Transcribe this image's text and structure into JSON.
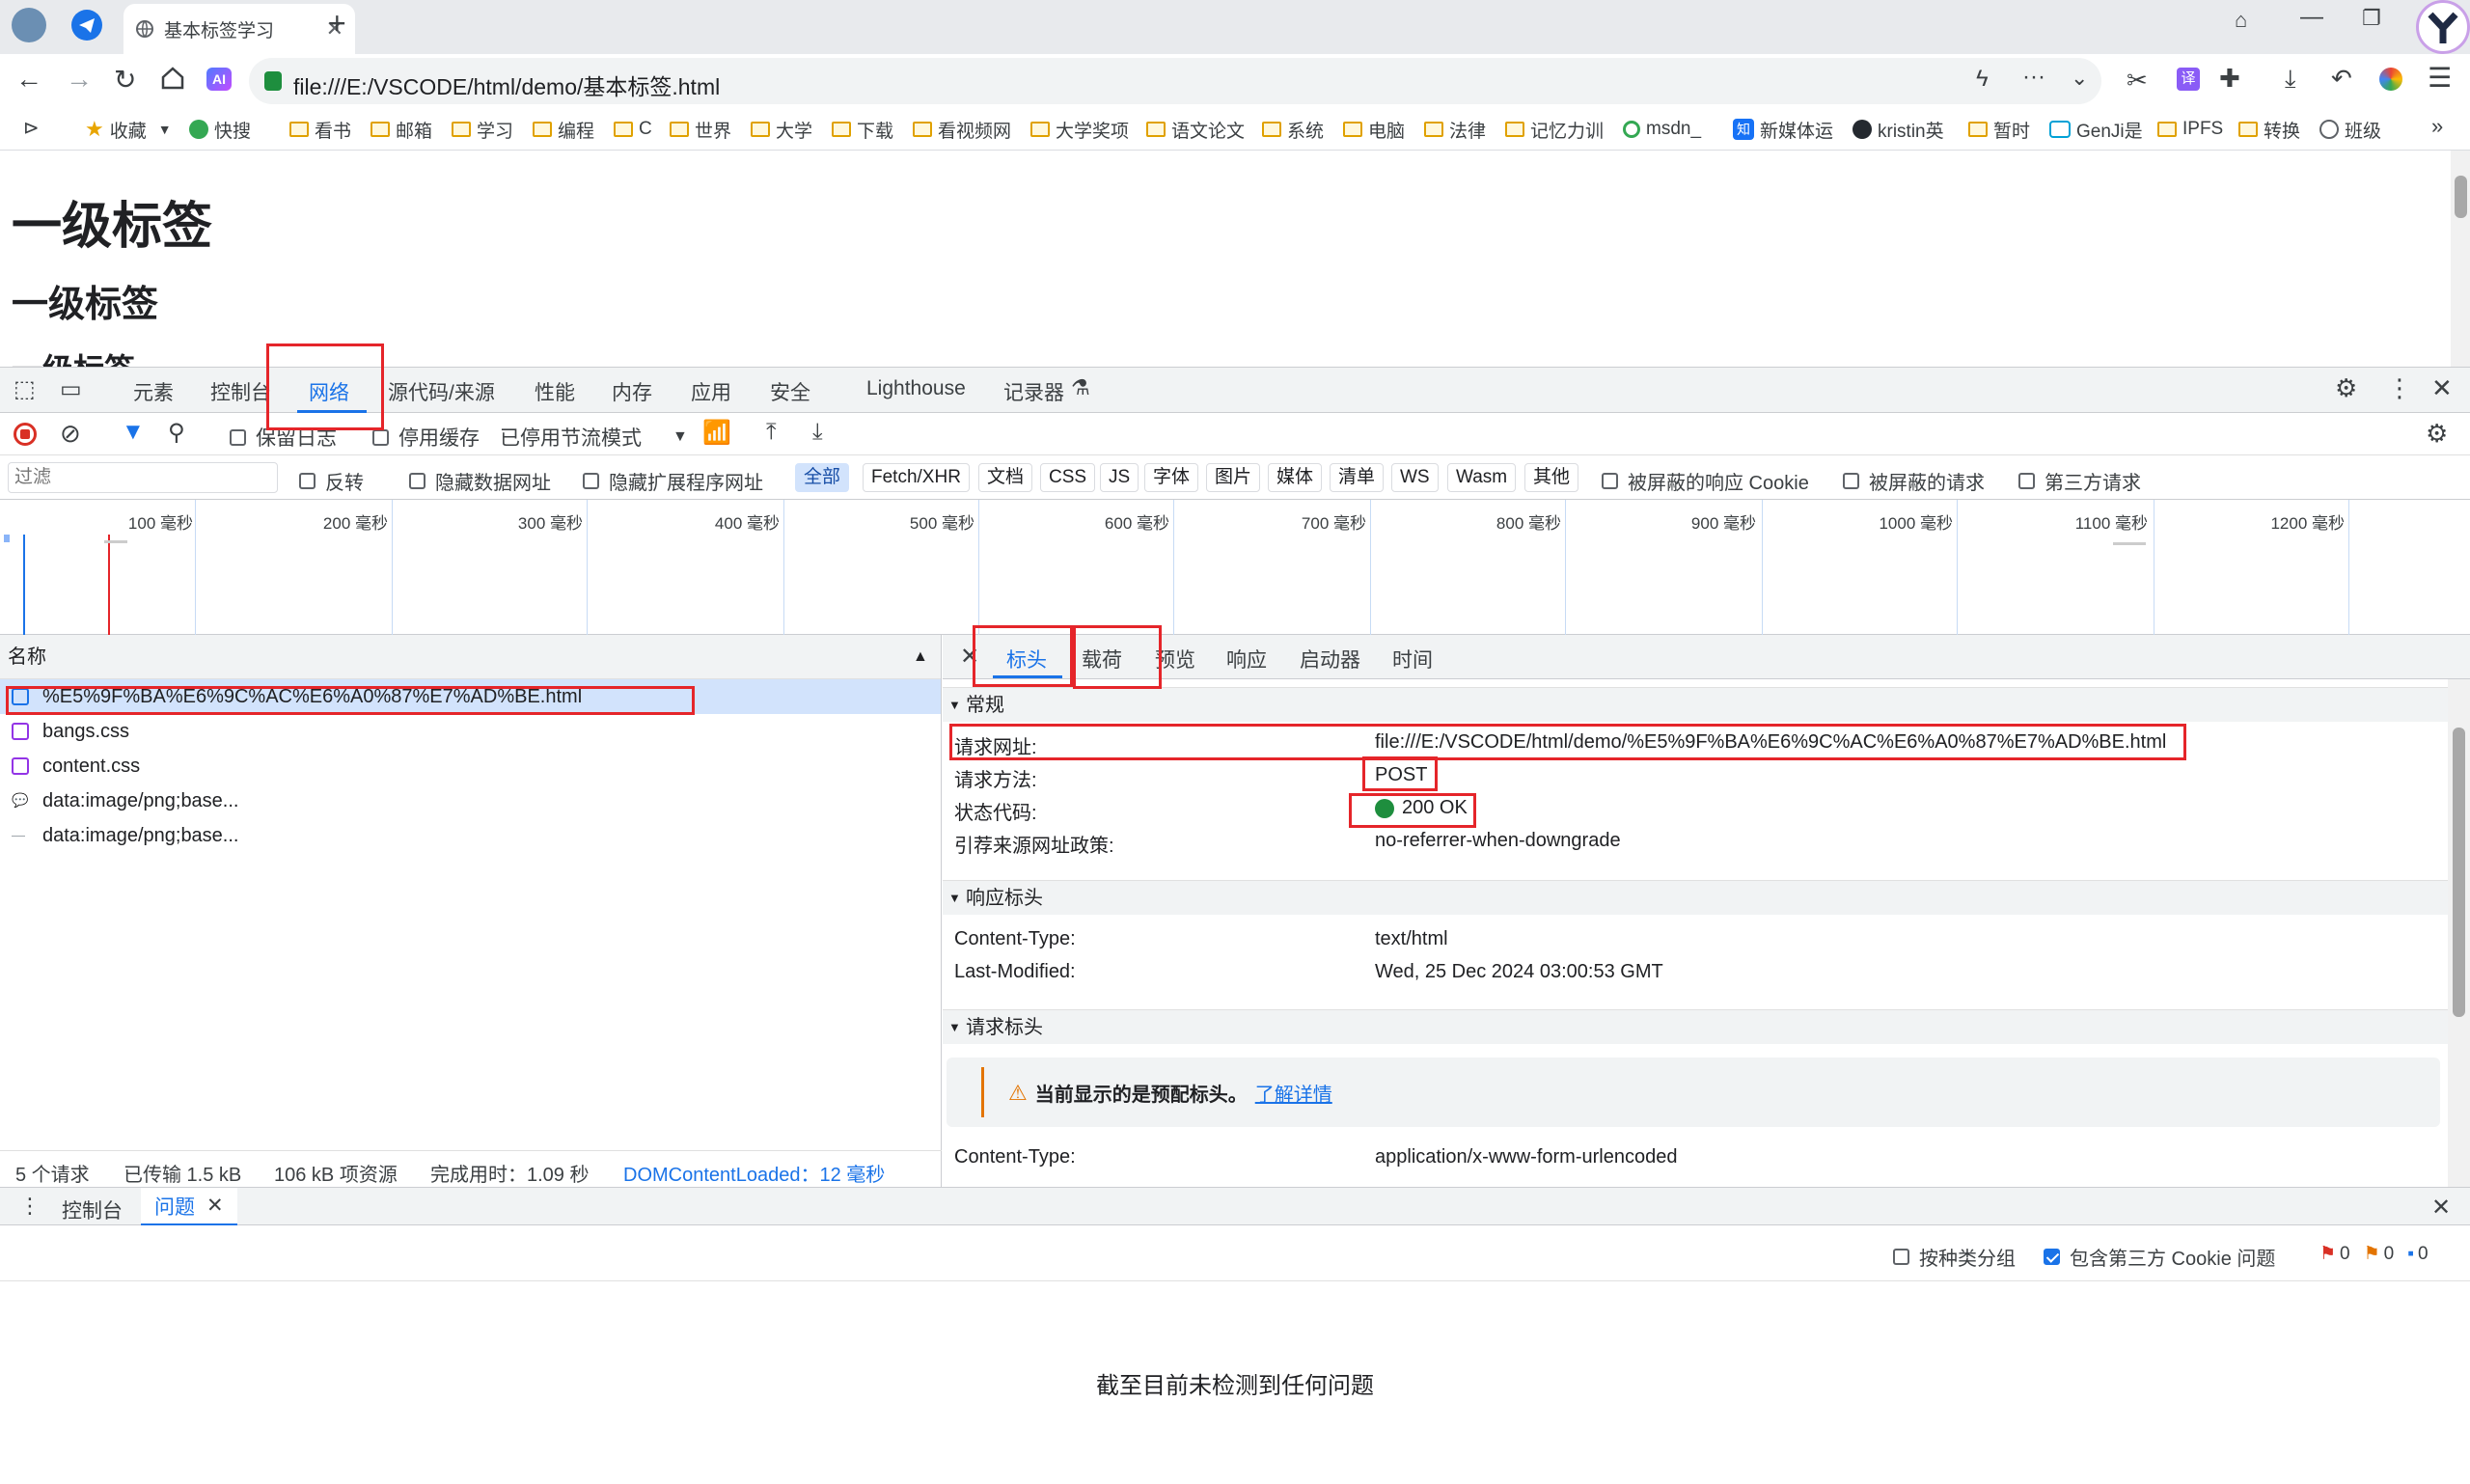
{
  "browser": {
    "tab_title": "基本标签学习",
    "url": "file:///E:/VSCODE/html/demo/基本标签.html",
    "bookmarks": [
      "收藏",
      "快搜",
      "看书",
      "邮箱",
      "学习",
      "编程",
      "C",
      "世界",
      "大学",
      "下载",
      "看视频网",
      "大学奖项",
      "语文论文",
      "系统",
      "电脑",
      "法律",
      "记忆力训",
      "msdn_",
      "新媒体运",
      "kristin英",
      "暂时",
      "GenJi是",
      "IPFS",
      "转换",
      "班级"
    ]
  },
  "page": {
    "h1": "一级标签",
    "h2": "一级标签",
    "h3": "一级标签"
  },
  "devtools": {
    "tabs": [
      "元素",
      "控制台",
      "网络",
      "源代码/来源",
      "性能",
      "内存",
      "应用",
      "安全",
      "Lighthouse",
      "记录器"
    ],
    "active_tab": "网络",
    "toolbar": {
      "preserve_log": "保留日志",
      "disable_cache": "停用缓存",
      "throttle": "已停用节流模式"
    },
    "filter": {
      "placeholder": "过滤",
      "invert": "反转",
      "hide_data_urls": "隐藏数据网址",
      "hide_ext_urls": "隐藏扩展程序网址",
      "types": [
        "全部",
        "Fetch/XHR",
        "文档",
        "CSS",
        "JS",
        "字体",
        "图片",
        "媒体",
        "清单",
        "WS",
        "Wasm",
        "其他"
      ],
      "active_type": "全部",
      "blocked_cookies": "被屏蔽的响应 Cookie",
      "blocked_requests": "被屏蔽的请求",
      "third_party": "第三方请求"
    },
    "timeline_ticks": [
      "100 毫秒",
      "200 毫秒",
      "300 毫秒",
      "400 毫秒",
      "500 毫秒",
      "600 毫秒",
      "700 毫秒",
      "800 毫秒",
      "900 毫秒",
      "1000 毫秒",
      "1100 毫秒",
      "1200 毫秒"
    ],
    "requests": {
      "column_name": "名称",
      "items": [
        {
          "name": "%E5%9F%BA%E6%9C%AC%E6%A0%87%E7%AD%BE.html",
          "type": "doc"
        },
        {
          "name": "bangs.css",
          "type": "css"
        },
        {
          "name": "content.css",
          "type": "css"
        },
        {
          "name": "data:image/png;base...",
          "type": "img"
        },
        {
          "name": "data:image/png;base...",
          "type": "img"
        }
      ]
    },
    "status": {
      "requests": "5 个请求",
      "transferred": "已传输 1.5 kB",
      "resources": "106 kB 项资源",
      "finish": "完成用时：1.09 秒",
      "dcl": "DOMContentLoaded：12 毫秒"
    },
    "detail": {
      "tabs": [
        "标头",
        "载荷",
        "预览",
        "响应",
        "启动器",
        "时间"
      ],
      "active_tab": "标头",
      "general_title": "常规",
      "general": [
        {
          "k": "请求网址:",
          "v": "file:///E:/VSCODE/html/demo/%E5%9F%BA%E6%9C%AC%E6%A0%87%E7%AD%BE.html"
        },
        {
          "k": "请求方法:",
          "v": "POST"
        },
        {
          "k": "状态代码:",
          "v": "200 OK"
        },
        {
          "k": "引荐来源网址政策:",
          "v": "no-referrer-when-downgrade"
        }
      ],
      "response_title": "响应标头",
      "response": [
        {
          "k": "Content-Type:",
          "v": "text/html"
        },
        {
          "k": "Last-Modified:",
          "v": "Wed, 25 Dec 2024 03:00:53 GMT"
        }
      ],
      "request_title": "请求标头",
      "warning": "当前显示的是预配标头。",
      "learn_more": "了解详情",
      "request": [
        {
          "k": "Content-Type:",
          "v": "application/x-www-form-urlencoded"
        }
      ]
    },
    "drawer": {
      "tabs": [
        "控制台",
        "问题"
      ],
      "active_tab": "问题",
      "group_by_kind": "按种类分组",
      "include_third_party": "包含第三方 Cookie 问题",
      "counts": [
        "0",
        "0",
        "0"
      ],
      "empty_message": "截至目前未检测到任何问题"
    },
    "colors": {
      "accent": "#1a73e8",
      "highlight": "#e5252a",
      "ok": "#1e8e3e",
      "warn": "#e37400"
    }
  }
}
